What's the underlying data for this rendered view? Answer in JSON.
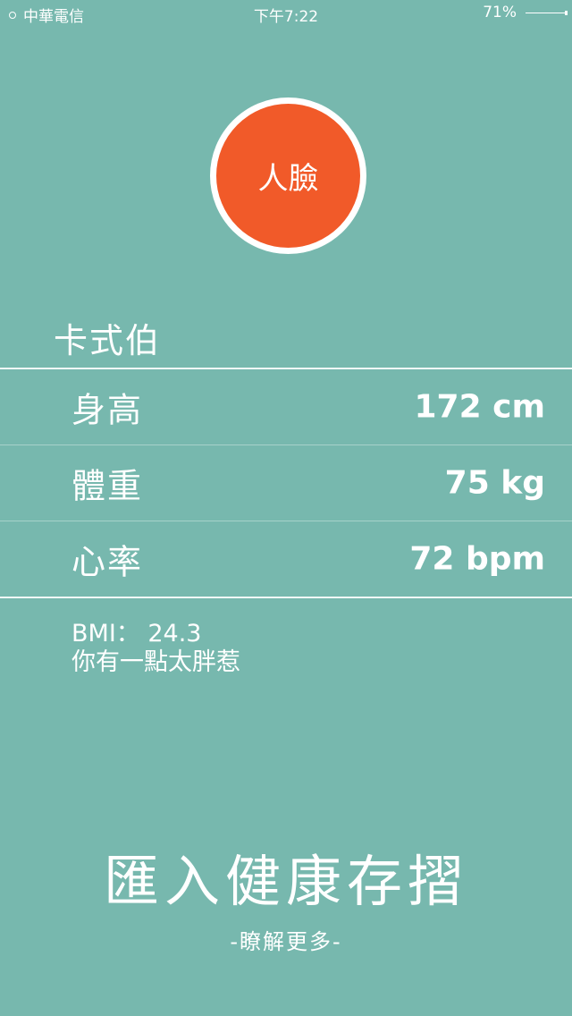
{
  "status_bar": {
    "carrier": "中華電信",
    "time": "下午7:22",
    "battery": "71%"
  },
  "avatar": {
    "label": "人臉"
  },
  "user": {
    "name": "卡式伯"
  },
  "stats": [
    {
      "label": "身高",
      "value": "172 cm"
    },
    {
      "label": "體重",
      "value": "75 kg"
    },
    {
      "label": "心率",
      "value": "72 bpm"
    }
  ],
  "bmi": {
    "text": "BMI： 24.3",
    "comment": "你有一點太胖惹"
  },
  "actions": {
    "import_label": "匯入健康存摺",
    "learn_more_label": "-瞭解更多-"
  },
  "colors": {
    "background": "#77b8ae",
    "avatar": "#f15a29",
    "text": "#ffffff"
  }
}
